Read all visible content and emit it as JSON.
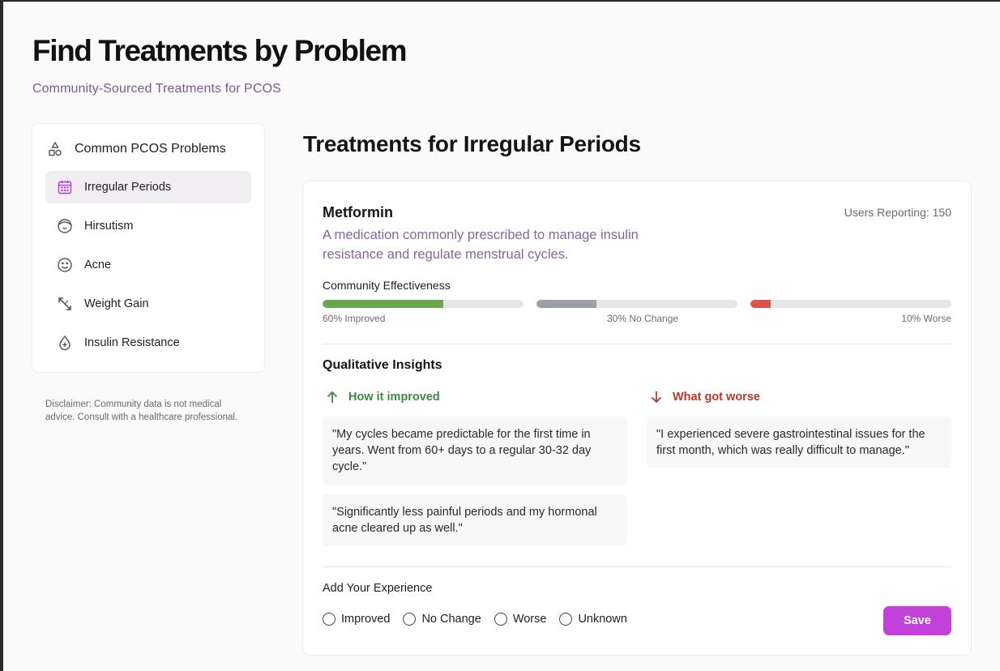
{
  "header": {
    "title": "Find Treatments by Problem",
    "subtitle": "Community-Sourced Treatments for PCOS"
  },
  "sidebar": {
    "heading": "Common PCOS Problems",
    "heading_icon": "shapes-icon",
    "items": [
      {
        "label": "Irregular Periods",
        "icon": "calendar-icon",
        "active": true
      },
      {
        "label": "Hirsutism",
        "icon": "face-hair-icon",
        "active": false
      },
      {
        "label": "Acne",
        "icon": "smiley-icon",
        "active": false
      },
      {
        "label": "Weight Gain",
        "icon": "resize-arrows-icon",
        "active": false
      },
      {
        "label": "Insulin Resistance",
        "icon": "drop-icon",
        "active": false
      }
    ],
    "disclaimer": "Disclaimer: Community data is not medical advice. Consult with a healthcare professional."
  },
  "main": {
    "title": "Treatments for Irregular Periods",
    "treatment": {
      "name": "Metformin",
      "users_reporting": "Users Reporting: 150",
      "description": "A medication commonly prescribed to manage insulin resistance and regulate menstrual cycles.",
      "effectiveness_label": "Community Effectiveness",
      "effectiveness": [
        {
          "label": "60% Improved",
          "percent": 60,
          "color": "#6aa84f"
        },
        {
          "label": "30% No Change",
          "percent": 30,
          "color": "#9aa0a6"
        },
        {
          "label": "10% Worse",
          "percent": 10,
          "color": "#d9534f"
        }
      ],
      "insights_title": "Qualitative Insights",
      "improved": {
        "heading": "How it improved",
        "color": "#3d8b40",
        "quotes": [
          "\"My cycles became predictable for the first time in years. Went from 60+ days to a regular 30-32 day cycle.\"",
          "\"Significantly less painful periods and my hormonal acne cleared up as well.\""
        ]
      },
      "worse": {
        "heading": "What got worse",
        "color": "#b8382c",
        "quotes": [
          "\"I experienced severe gastrointestinal issues for the first month, which was really difficult to manage.\""
        ]
      }
    },
    "experience": {
      "label": "Add Your Experience",
      "options": [
        "Improved",
        "No Change",
        "Worse",
        "Unknown"
      ],
      "save_label": "Save"
    }
  },
  "colors": {
    "accent": "#c241d9",
    "subtitle": "#7a5a8c"
  }
}
